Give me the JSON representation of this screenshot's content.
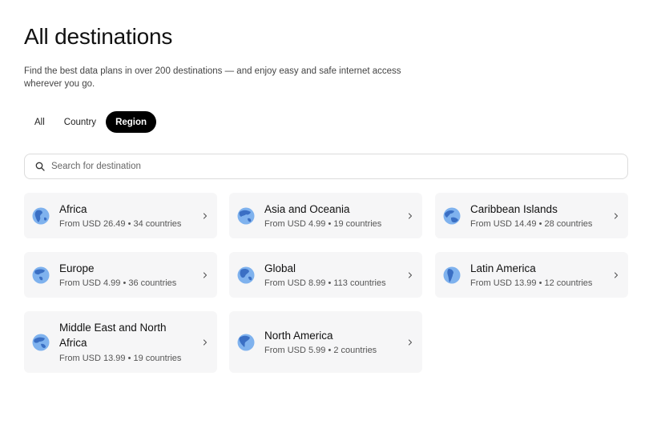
{
  "page": {
    "title": "All destinations",
    "subtitle": "Find the best data plans in over 200 destinations — and enjoy easy and safe internet access wherever you go."
  },
  "tabs": [
    {
      "label": "All",
      "active": false
    },
    {
      "label": "Country",
      "active": false
    },
    {
      "label": "Region",
      "active": true
    }
  ],
  "search": {
    "placeholder": "Search for destination",
    "value": ""
  },
  "regions": [
    {
      "name": "Africa",
      "meta": "From USD 26.49 • 34 countries"
    },
    {
      "name": "Asia and Oceania",
      "meta": "From USD 4.99 • 19 countries"
    },
    {
      "name": "Caribbean Islands",
      "meta": "From USD 14.49 • 28 countries"
    },
    {
      "name": "Europe",
      "meta": "From USD 4.99 • 36 countries"
    },
    {
      "name": "Global",
      "meta": "From USD 8.99 • 113 countries"
    },
    {
      "name": "Latin America",
      "meta": "From USD 13.99 • 12 countries"
    },
    {
      "name": "Middle East and North Africa",
      "meta": "From USD 13.99 • 19 countries"
    },
    {
      "name": "North America",
      "meta": "From USD 5.99 • 2 countries"
    }
  ],
  "icons": {
    "region": "globe-icon",
    "chevron": "chevron-right-icon",
    "search": "search-icon"
  },
  "colors": {
    "active_tab_bg": "#000000",
    "card_bg": "#f6f6f7",
    "globe_ocean": "#7fb2ee",
    "globe_land": "#3a6fc4"
  }
}
